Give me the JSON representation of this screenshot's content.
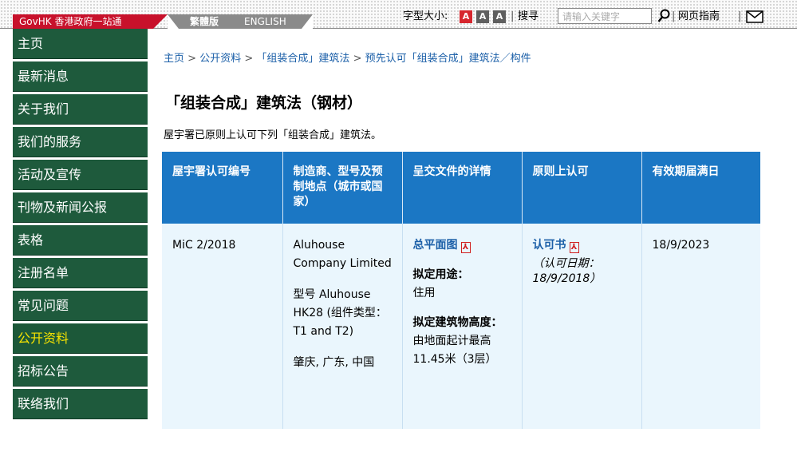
{
  "header": {
    "govhk": "GovHK 香港政府一站通",
    "lang_trad": "繁體版",
    "lang_en": "ENGLISH",
    "font_size_label": "字型大小:",
    "font_sizes": [
      "A",
      "A",
      "A"
    ],
    "font_colors": [
      "#d7262e",
      "#5f5f5f",
      "#5f5f5f"
    ],
    "search_label": "搜寻",
    "search_placeholder": "请输入关键字",
    "guide_label": "网页指南",
    "sep": "|"
  },
  "sidebar": {
    "items": [
      {
        "label": "主页"
      },
      {
        "label": "最新消息"
      },
      {
        "label": "关于我们"
      },
      {
        "label": "我们的服务"
      },
      {
        "label": "活动及宣传"
      },
      {
        "label": "刊物及新闻公报"
      },
      {
        "label": "表格"
      },
      {
        "label": "注册名单"
      },
      {
        "label": "常见问题"
      },
      {
        "label": "公开资料"
      },
      {
        "label": "招标公告"
      },
      {
        "label": "联络我们"
      }
    ],
    "active_index": 9
  },
  "breadcrumb": {
    "items": [
      "主页",
      "公开资料",
      "「组装合成」建筑法",
      "预先认可「组装合成」建筑法／构件"
    ],
    "sep": ">"
  },
  "page": {
    "title": "「组装合成」建筑法（钢材）",
    "intro": "屋宇署已原则上认可下列「组装合成」建筑法。"
  },
  "table": {
    "headers": [
      "屋宇署认可编号",
      "制造商、型号及预制地点（城市或国家）",
      "呈交文件的详情",
      "原则上认可",
      "有效期届满日"
    ],
    "row": {
      "id": "MiC 2/2018",
      "manufacturer": "Aluhouse Company Limited",
      "model": "型号 Aluhouse HK28 (组件类型：T1 and T2)",
      "location": "肇庆, 广东, 中国",
      "doc_link": "总平面图",
      "use_label": "拟定用途：",
      "use_value": "住用",
      "height_label": "拟定建筑物高度：",
      "height_value": "由地面起计最高11.45米（3层）",
      "approval_link": "认可书",
      "approval_date": "（认可日期：18/9/2018）",
      "expiry": "18/9/2023"
    }
  },
  "colors": {
    "govhk_red": "#c8112b",
    "nav_green": "#1e5a3c",
    "active_yellow": "#f7e300",
    "table_header_blue": "#1b77c4",
    "link_blue": "#1b5fa8",
    "cell_bg": "#eaf6fd"
  }
}
